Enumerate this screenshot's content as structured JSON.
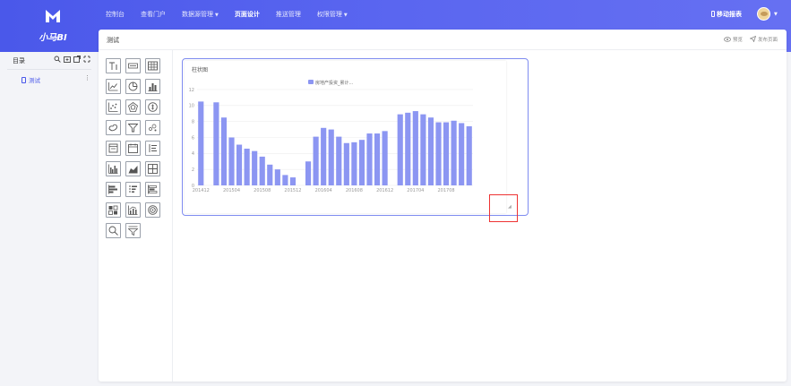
{
  "app": {
    "logo_text": "小马BI"
  },
  "nav": {
    "items": [
      {
        "label": "控制台",
        "active": false,
        "dropdown": false
      },
      {
        "label": "查看门户",
        "active": false,
        "dropdown": false
      },
      {
        "label": "数据源管理",
        "active": false,
        "dropdown": true
      },
      {
        "label": "页面设计",
        "active": true,
        "dropdown": false
      },
      {
        "label": "推送管理",
        "active": false,
        "dropdown": false
      },
      {
        "label": "权限管理",
        "active": false,
        "dropdown": true
      }
    ],
    "mobile_report": "移动报表"
  },
  "sidebar": {
    "title": "目录",
    "icons": [
      "search-icon",
      "add-folder-icon",
      "export-icon",
      "refresh-icon"
    ],
    "items": [
      {
        "label": "测试",
        "active": true
      }
    ]
  },
  "page": {
    "title": "测试",
    "preview_label": "预览",
    "publish_label": "发布页面"
  },
  "palette": {
    "widgets": [
      "text-widget-icon",
      "number-widget-icon",
      "table-widget-icon",
      "line-chart-widget-icon",
      "pie-chart-widget-icon",
      "bar-chart-widget-icon",
      "scatter-widget-icon",
      "radar-widget-icon",
      "gauge-widget-icon",
      "map-widget-icon",
      "funnel-widget-icon",
      "bubble-widget-icon",
      "card-widget-icon",
      "calendar-widget-icon",
      "list-widget-icon",
      "grouped-bar-widget-icon",
      "area-chart-widget-icon",
      "grid-widget-icon",
      "horizontal-bar-widget-icon",
      "ranking-widget-icon",
      "stacked-bar-widget-icon",
      "matrix-widget-icon",
      "combo-chart-widget-icon",
      "ring-widget-icon",
      "search-widget-icon",
      "filter-widget-icon"
    ]
  },
  "chart_card": {
    "title": "柱状图",
    "resize_glyph": "◢"
  },
  "colors": {
    "accent": "#4a58ea",
    "bar": "#8c96f2",
    "highlight": "#e33333"
  },
  "chart_data": {
    "type": "bar",
    "title": "",
    "legend": [
      "房地产投资_累计..."
    ],
    "legend_position": "top-center",
    "series": [
      {
        "name": "房地产投资_累计...",
        "values": [
          10.5,
          0,
          10.4,
          8.5,
          6.0,
          5.1,
          4.6,
          4.3,
          3.6,
          2.6,
          2.0,
          1.3,
          1.0,
          0,
          3.0,
          6.1,
          7.2,
          7.0,
          6.1,
          5.3,
          5.4,
          5.7,
          6.5,
          6.5,
          6.8,
          0,
          8.9,
          9.1,
          9.3,
          8.9,
          8.5,
          7.9,
          7.9,
          8.1,
          7.8,
          7.4
        ]
      }
    ],
    "xtick_labels": [
      "201412",
      "201504",
      "201508",
      "201512",
      "201604",
      "201608",
      "201612",
      "201704",
      "201708"
    ],
    "yticks": [
      0,
      2,
      4,
      6,
      8,
      10,
      12
    ],
    "ylim": [
      0,
      12
    ],
    "grid": true
  }
}
